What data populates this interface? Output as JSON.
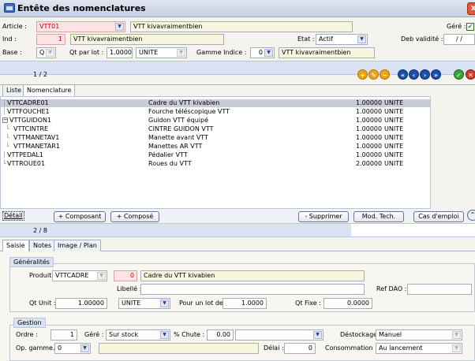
{
  "window": {
    "title": "Entête des nomenclatures"
  },
  "header": {
    "article_label": "Article :",
    "article_value": "VTT01",
    "article_desc": "VTT kivavraimentbien",
    "gere_label": "Géré :",
    "ind_label": "Ind :",
    "ind_value": "1",
    "ind_desc": "VTT kivavraimentbien",
    "etat_label": "Etat :",
    "etat_value": "Actif",
    "deb_validite_label": "Deb validité :",
    "deb_validite_value": "/ /",
    "base_label": "Base :",
    "base_value": "Q",
    "qt_par_lot_label": "Qt par lot :",
    "qt_par_lot_value": "1.0000",
    "unite_value": "UNITE",
    "gamme_indice_label": "Gamme Indice :",
    "gamme_indice_value": "0",
    "gamme_desc": "VTT kivavraimentbien"
  },
  "top_counter": "1 / 2",
  "tabs_top": [
    "Liste",
    "Nomenclature"
  ],
  "tree": {
    "rows": [
      {
        "code": "VTTCADRE01",
        "desc": "Cadre du VTT kivabien",
        "qty": "1.00000",
        "unit": "UNITE",
        "selected": true
      },
      {
        "code": "VTTFOUCHE1",
        "desc": "Fourche téléscopique VTT",
        "qty": "1.00000",
        "unit": "UNITE"
      },
      {
        "code": "VTTGUIDON1",
        "desc": "Guidon VTT équipé",
        "qty": "1.00000",
        "unit": "UNITE"
      },
      {
        "code": "VTTCINTRE",
        "desc": "CINTRE GUIDON VTT",
        "qty": "1.00000",
        "unit": "UNITE"
      },
      {
        "code": "VTTMANETAV1",
        "desc": "Manette avant VTT",
        "qty": "1.00000",
        "unit": "UNITE"
      },
      {
        "code": "VTTMANETAR1",
        "desc": "Manettes AR VTT",
        "qty": "1.00000",
        "unit": "UNITE"
      },
      {
        "code": "VTTPEDAL1",
        "desc": "Pédalier VTT",
        "qty": "1.00000",
        "unit": "UNITE"
      },
      {
        "code": "VTTROUE01",
        "desc": "Roues du VTT",
        "qty": "2.00000",
        "unit": "UNITE"
      }
    ]
  },
  "actions": {
    "detail": "Détail",
    "add_composant": "+ Composant",
    "add_compose": "+ Composé",
    "supprimer": "- Supprimer",
    "mod_tech": "Mod. Tech.",
    "cas_emploi": "Cas d'emploi"
  },
  "bottom_counter": "2 / 8",
  "tabs_bottom": [
    "Saisie",
    "Notes",
    "Image / Plan"
  ],
  "generalites": {
    "title": "Généralités",
    "produit_label": "Produit :",
    "produit_value": "VTTCADRE",
    "produit_ind": "0",
    "produit_desc": "Cadre du VTT kivabien",
    "libelle_label": "Libellé :",
    "ref_dao_label": "Ref DAO :",
    "qt_unit_label": "Qt Unit :",
    "qt_unit_value": "1.00000",
    "unite_value": "UNITE",
    "pour_un_lot_label": "Pour un lot de",
    "pour_un_lot_value": "1.0000",
    "qt_fixe_label": "Qt Fixe :",
    "qt_fixe_value": "0.0000"
  },
  "gestion": {
    "title": "Gestion",
    "ordre_label": "Ordre :",
    "ordre_value": "1",
    "gere_label": "Géré :",
    "gere_value": "Sur stock",
    "chute_label": "% Chute :",
    "chute_value": "0.00",
    "destockage_label": "Déstockage :",
    "destockage_value": "Manuel",
    "op_gamme_label": "Op. gamme. :",
    "op_gamme_value": "0",
    "delai_label": "Délai :",
    "delai_value": "0",
    "consommation_label": "Consommation :",
    "consommation_value": "Au lancement"
  },
  "colors": {
    "accent": "#d9e3f3",
    "pink_field": "#fde3e3",
    "selected_row": "#c7ccd6"
  }
}
